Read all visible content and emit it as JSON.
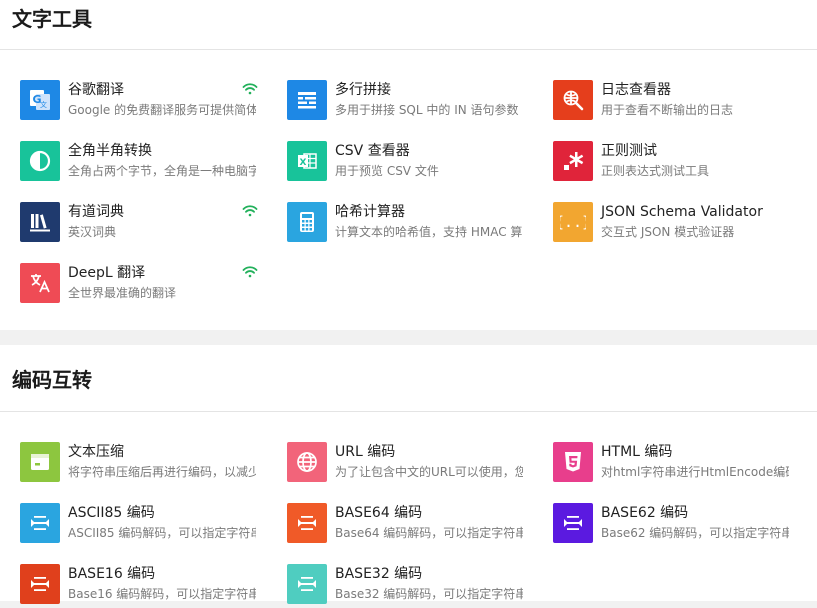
{
  "sections": [
    {
      "title": "文字工具",
      "tools": [
        {
          "name": "谷歌翻译",
          "desc": "Google 的免费翻译服务可提供简体",
          "icon": "google-translate-icon",
          "color": "#1e88e5",
          "online": true
        },
        {
          "name": "多行拼接",
          "desc": "多用于拼接 SQL 中的 IN 语句参数",
          "icon": "multiline-join-icon",
          "color": "#1e88e5",
          "online": false
        },
        {
          "name": "日志查看器",
          "desc": "用于查看不断输出的日志",
          "icon": "log-search-icon",
          "color": "#e53e1c",
          "online": false
        },
        {
          "name": "全角半角转换",
          "desc": "全角占两个字节，全角是一种电脑字",
          "icon": "half-circle-icon",
          "color": "#18c39a",
          "online": false
        },
        {
          "name": "CSV 查看器",
          "desc": "用于预览 CSV 文件",
          "icon": "excel-icon",
          "color": "#18c39a",
          "online": false
        },
        {
          "name": "正则测试",
          "desc": "正则表达式测试工具",
          "icon": "regex-icon",
          "color": "#e0243a",
          "online": false
        },
        {
          "name": "有道词典",
          "desc": "英汉词典",
          "icon": "books-icon",
          "color": "#1f3a6e",
          "online": true
        },
        {
          "name": "哈希计算器",
          "desc": "计算文本的哈希值，支持 HMAC 算",
          "icon": "calculator-icon",
          "color": "#2aa5e0",
          "online": false
        },
        {
          "name": "JSON Schema Validator",
          "desc": "交互式 JSON 模式验证器",
          "icon": "json-braces-icon",
          "color": "#f2a630",
          "online": false
        },
        {
          "name": "DeepL 翻译",
          "desc": "全世界最准确的翻译",
          "icon": "translate-icon",
          "color": "#ef4b55",
          "online": true
        }
      ]
    },
    {
      "title": "编码互转",
      "tools": [
        {
          "name": "文本压缩",
          "desc": "将字符串压缩后再进行编码，以减少",
          "icon": "compress-icon",
          "color": "#8dc63f",
          "online": false
        },
        {
          "name": "URL 编码",
          "desc": "为了让包含中文的URL可以使用，您",
          "icon": "globe-icon",
          "color": "#f2647a",
          "online": false
        },
        {
          "name": "HTML 编码",
          "desc": "对html字符串进行HtmlEncode编码",
          "icon": "html5-icon",
          "color": "#e83e8c",
          "online": false
        },
        {
          "name": "ASCII85 编码",
          "desc": "ASCII85 编码解码，可以指定字符串",
          "icon": "encode-arrows-icon",
          "color": "#2aa5e0",
          "online": false
        },
        {
          "name": "BASE64 编码",
          "desc": "Base64 编码解码，可以指定字符串",
          "icon": "encode-arrows-icon",
          "color": "#f05a28",
          "online": false
        },
        {
          "name": "BASE62 编码",
          "desc": "Base62 编码解码，可以指定字符串",
          "icon": "encode-arrows-icon",
          "color": "#5b1ae0",
          "online": false
        },
        {
          "name": "BASE16 编码",
          "desc": "Base16 编码解码，可以指定字符串",
          "icon": "encode-arrows-icon",
          "color": "#e0401c",
          "online": false
        },
        {
          "name": "BASE32 编码",
          "desc": "Base32 编码解码，可以指定字符串",
          "icon": "encode-arrows-icon",
          "color": "#4fcdc0",
          "online": false
        }
      ]
    }
  ]
}
